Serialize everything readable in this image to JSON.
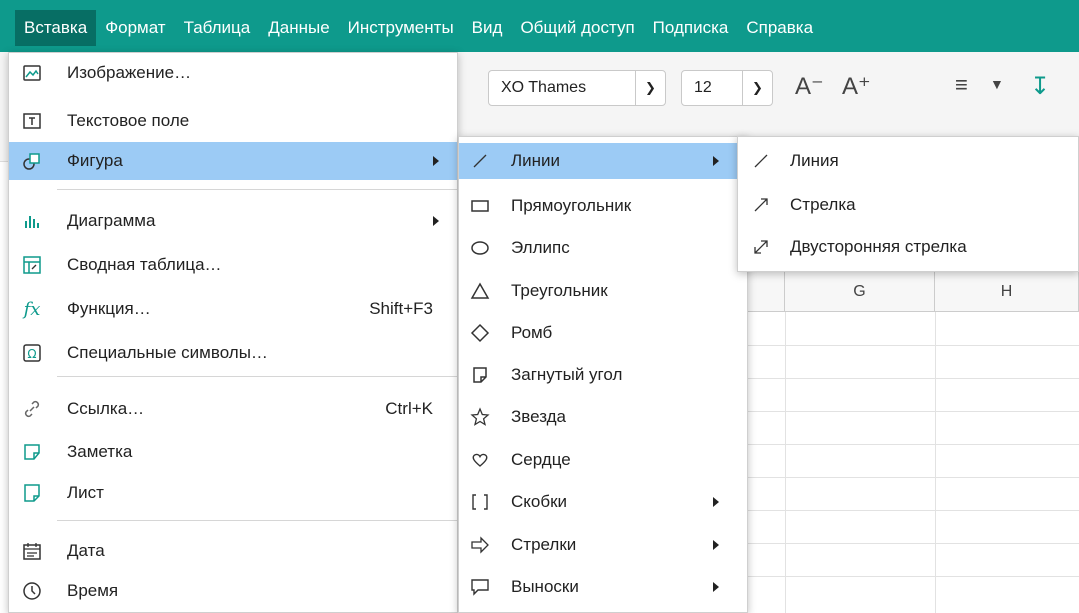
{
  "menubar": {
    "items": [
      "Вставка",
      "Формат",
      "Таблица",
      "Данные",
      "Инструменты",
      "Вид",
      "Общий доступ",
      "Подписка",
      "Справка"
    ]
  },
  "toolbar": {
    "font_name": "XO Thames",
    "font_size": "12"
  },
  "sheet": {
    "columns": [
      "G",
      "H"
    ]
  },
  "insert_menu": {
    "items": [
      {
        "label": "Изображение…",
        "icon": "image-icon"
      },
      {
        "label": "Текстовое поле",
        "icon": "text-box-icon"
      },
      {
        "label": "Фигура",
        "icon": "shape-icon",
        "submenu": true,
        "highlighted": true
      },
      {
        "label": "Диаграмма",
        "icon": "chart-icon",
        "submenu": true
      },
      {
        "label": "Сводная таблица…",
        "icon": "pivot-table-icon"
      },
      {
        "label": "Функция…",
        "icon": "function-icon",
        "shortcut": "Shift+F3"
      },
      {
        "label": "Специальные символы…",
        "icon": "omega-icon"
      },
      {
        "label": "Ссылка…",
        "icon": "link-icon",
        "shortcut": "Ctrl+K"
      },
      {
        "label": "Заметка",
        "icon": "note-icon"
      },
      {
        "label": "Лист",
        "icon": "sheet-icon"
      },
      {
        "label": "Дата",
        "icon": "calendar-icon"
      },
      {
        "label": "Время",
        "icon": "clock-icon"
      }
    ]
  },
  "shape_menu": {
    "items": [
      {
        "label": "Линии",
        "icon": "line-icon",
        "submenu": true,
        "highlighted": true
      },
      {
        "label": "Прямоугольник",
        "icon": "rectangle-icon"
      },
      {
        "label": "Эллипс",
        "icon": "ellipse-icon"
      },
      {
        "label": "Треугольник",
        "icon": "triangle-icon"
      },
      {
        "label": "Ромб",
        "icon": "rhombus-icon"
      },
      {
        "label": "Загнутый угол",
        "icon": "folded-corner-icon"
      },
      {
        "label": "Звезда",
        "icon": "star-icon"
      },
      {
        "label": "Сердце",
        "icon": "heart-icon"
      },
      {
        "label": "Скобки",
        "icon": "brackets-icon",
        "submenu": true
      },
      {
        "label": "Стрелки",
        "icon": "arrows-icon",
        "submenu": true
      },
      {
        "label": "Выноски",
        "icon": "callout-icon",
        "submenu": true
      }
    ]
  },
  "lines_menu": {
    "items": [
      {
        "label": "Линия",
        "icon": "line-icon"
      },
      {
        "label": "Стрелка",
        "icon": "arrow-icon"
      },
      {
        "label": "Двусторонняя стрелка",
        "icon": "double-arrow-icon"
      }
    ]
  },
  "colors": {
    "menubar": "#0e9a8c",
    "active_menu": "#076e64",
    "highlight": "#9ccbf5",
    "icon_accent": "#0e9a8c"
  }
}
